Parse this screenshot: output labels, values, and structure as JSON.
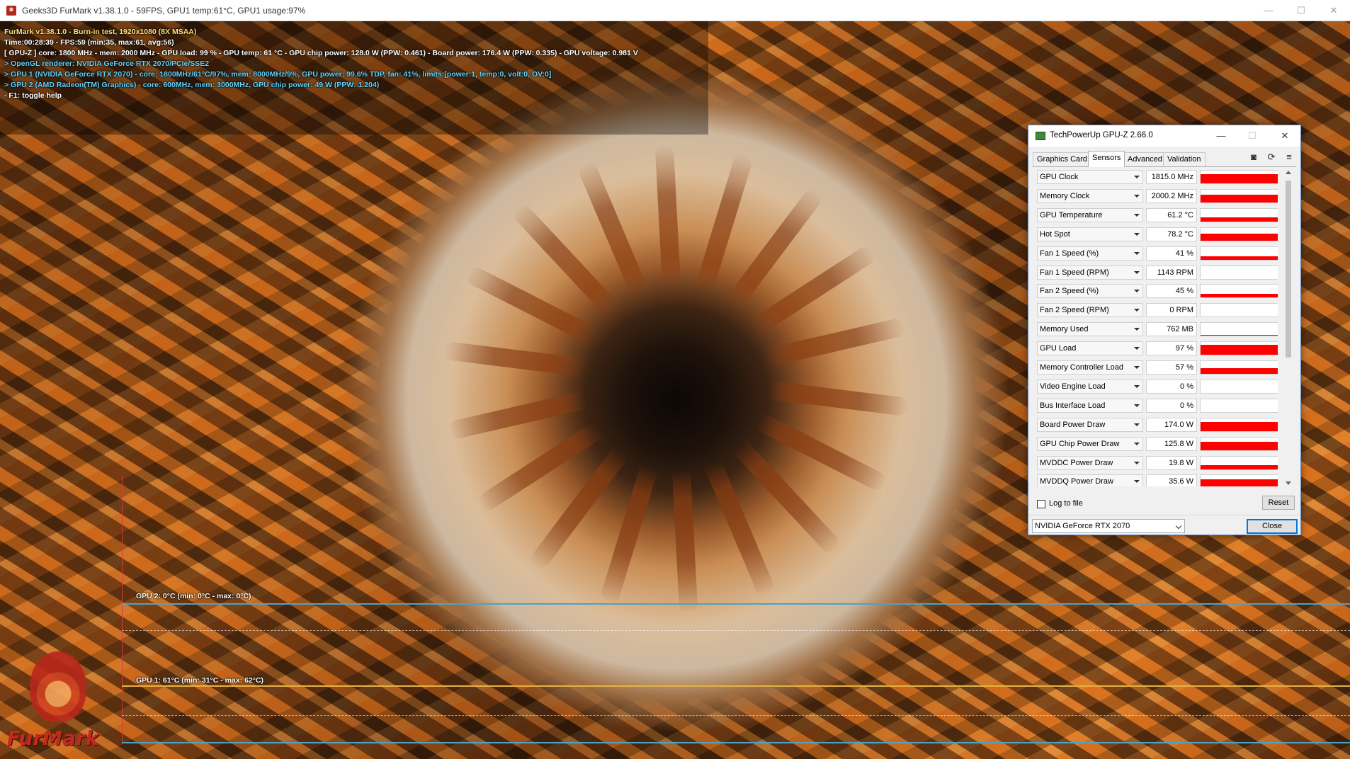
{
  "furmark": {
    "title": "Geeks3D FurMark v1.38.1.0 - 59FPS, GPU1 temp:61°C, GPU1 usage:97%",
    "osd": {
      "line1": "FurMark v1.38.1.0 - Burn-in test, 1920x1080 (8X MSAA)",
      "line2": "Time:00:28:39 - FPS:59 (min:35, max:61, avg:56)",
      "line3": "[ GPU-Z ] core: 1800 MHz - mem: 2000 MHz - GPU load: 99 % - GPU temp: 61 °C - GPU chip power: 128.0 W (PPW: 0.461) - Board power: 176.4 W (PPW: 0.335) - GPU voltage: 0.981 V",
      "line4": "> OpenGL renderer: NVIDIA GeForce RTX 2070/PCIe/SSE2",
      "line5": "> GPU 1 (NVIDIA GeForce RTX 2070) - core: 1800MHz/61°C/97%, mem: 8000MHz/9%, GPU power: 99.6% TDP, fan: 41%, limits:[power:1, temp:0, volt:0, OV:0]",
      "line6": "> GPU 2 (AMD Radeon(TM) Graphics) - core: 600MHz, mem: 3000MHz, GPU chip power: 49 W (PPW: 1.204)",
      "line7": "- F1: toggle help"
    },
    "graphs": {
      "gpu2_label": "GPU 2: 0°C (min: 0°C - max: 0°C)",
      "gpu1_label": "GPU 1: 61°C (min: 31°C - max: 62°C)"
    },
    "logo_text": "FurMark"
  },
  "gpuz": {
    "title": "TechPowerUp GPU-Z 2.66.0",
    "tabs": [
      "Graphics Card",
      "Sensors",
      "Advanced",
      "Validation"
    ],
    "active_tab": "Sensors",
    "sensor_fill_color": "#ff0000",
    "sensors": [
      {
        "name": "GPU Clock",
        "value": "1815.0 MHz",
        "level": 0.7
      },
      {
        "name": "Memory Clock",
        "value": "2000.2 MHz",
        "level": 0.6
      },
      {
        "name": "GPU Temperature",
        "value": "61.2 °C",
        "level": 0.35
      },
      {
        "name": "Hot Spot",
        "value": "78.2 °C",
        "level": 0.55
      },
      {
        "name": "Fan 1 Speed (%)",
        "value": "41 %",
        "level": 0.3
      },
      {
        "name": "Fan 1 Speed (RPM)",
        "value": "1143 RPM",
        "level": 0
      },
      {
        "name": "Fan 2 Speed (%)",
        "value": "45 %",
        "level": 0.3
      },
      {
        "name": "Fan 2 Speed (RPM)",
        "value": "0 RPM",
        "level": 0
      },
      {
        "name": "Memory Used",
        "value": "762 MB",
        "level": 0.06
      },
      {
        "name": "GPU Load",
        "value": "97 %",
        "level": 0.75
      },
      {
        "name": "Memory Controller Load",
        "value": "57 %",
        "level": 0.45
      },
      {
        "name": "Video Engine Load",
        "value": "0 %",
        "level": 0
      },
      {
        "name": "Bus Interface Load",
        "value": "0 %",
        "level": 0
      },
      {
        "name": "Board Power Draw",
        "value": "174.0 W",
        "level": 0.7
      },
      {
        "name": "GPU Chip Power Draw",
        "value": "125.8 W",
        "level": 0.65
      },
      {
        "name": "MVDDC Power Draw",
        "value": "19.8 W",
        "level": 0.35
      },
      {
        "name": "MVDDQ Power Draw",
        "value": "35.6 W",
        "level": 0.65
      }
    ],
    "log_to_file": "Log to file",
    "reset": "Reset",
    "device": "NVIDIA GeForce RTX 2070",
    "close": "Close"
  }
}
